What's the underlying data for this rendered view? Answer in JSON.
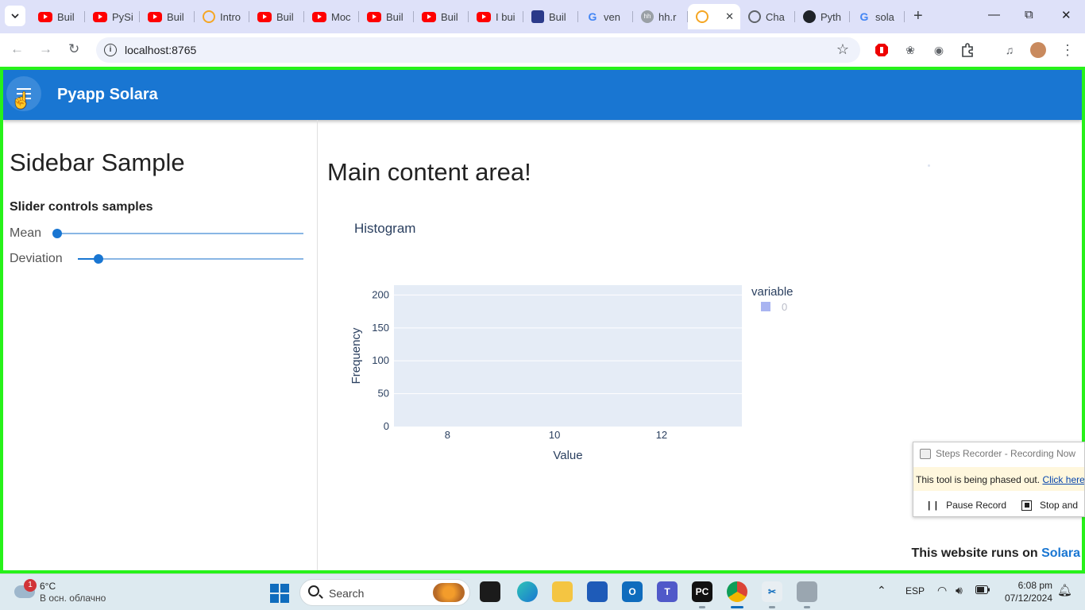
{
  "browser": {
    "tabs": [
      {
        "label": "Buil",
        "icon": "youtube-icon"
      },
      {
        "label": "PySi",
        "icon": "youtube-icon"
      },
      {
        "label": "Buil",
        "icon": "youtube-icon"
      },
      {
        "label": "Intro",
        "icon": "solara-icon"
      },
      {
        "label": "Buil",
        "icon": "youtube-icon"
      },
      {
        "label": "Moc",
        "icon": "youtube-icon"
      },
      {
        "label": "Buil",
        "icon": "youtube-icon"
      },
      {
        "label": "Buil",
        "icon": "youtube-icon"
      },
      {
        "label": "I bui",
        "icon": "youtube-icon"
      },
      {
        "label": "Buil",
        "icon": "profile-icon"
      },
      {
        "label": "ven",
        "icon": "google-icon"
      },
      {
        "label": "hh.r",
        "icon": "hh-icon"
      },
      {
        "label": "",
        "icon": "solara-icon",
        "active": true
      },
      {
        "label": "Cha",
        "icon": "globe-icon"
      },
      {
        "label": "Pyth",
        "icon": "github-icon"
      },
      {
        "label": "sola",
        "icon": "google-icon"
      }
    ],
    "url": "localhost:8765"
  },
  "app": {
    "title": "Pyapp Solara"
  },
  "sidebar": {
    "title": "Sidebar Sample",
    "subtitle": "Slider controls samples",
    "sliders": [
      {
        "label": "Mean",
        "value_fraction": 0.0
      },
      {
        "label": "Deviation",
        "value_fraction": 0.093
      }
    ]
  },
  "main": {
    "title": "Main content area!",
    "footer_prefix": "This website runs on ",
    "footer_brand": "Solara"
  },
  "chart_data": {
    "type": "bar",
    "title": "Histogram",
    "xlabel": "Value",
    "ylabel": "Frequency",
    "xlim": [
      7.0,
      13.5
    ],
    "ylim": [
      0,
      215
    ],
    "x_ticks": [
      8,
      10,
      12
    ],
    "y_ticks": [
      0,
      50,
      100,
      150,
      200
    ],
    "legend_title": "variable",
    "series": [
      {
        "name": "0",
        "values": []
      }
    ],
    "legend_position": "top-right",
    "grid": true,
    "colors": {
      "plot_bg": "#e5ecf6",
      "series": "#a9b4f1"
    }
  },
  "recorder": {
    "title": "Steps Recorder - Recording Now",
    "warning": "This tool is being phased out. ",
    "link": "Click here to",
    "pause": "Pause Record",
    "stop": "Stop and"
  },
  "taskbar": {
    "weather_badge": "1",
    "temp": "6°C",
    "condition": "В осн. облачно",
    "search": "Search",
    "lang": "ESP",
    "time": "6:08 pm",
    "date": "07/12/2024"
  }
}
